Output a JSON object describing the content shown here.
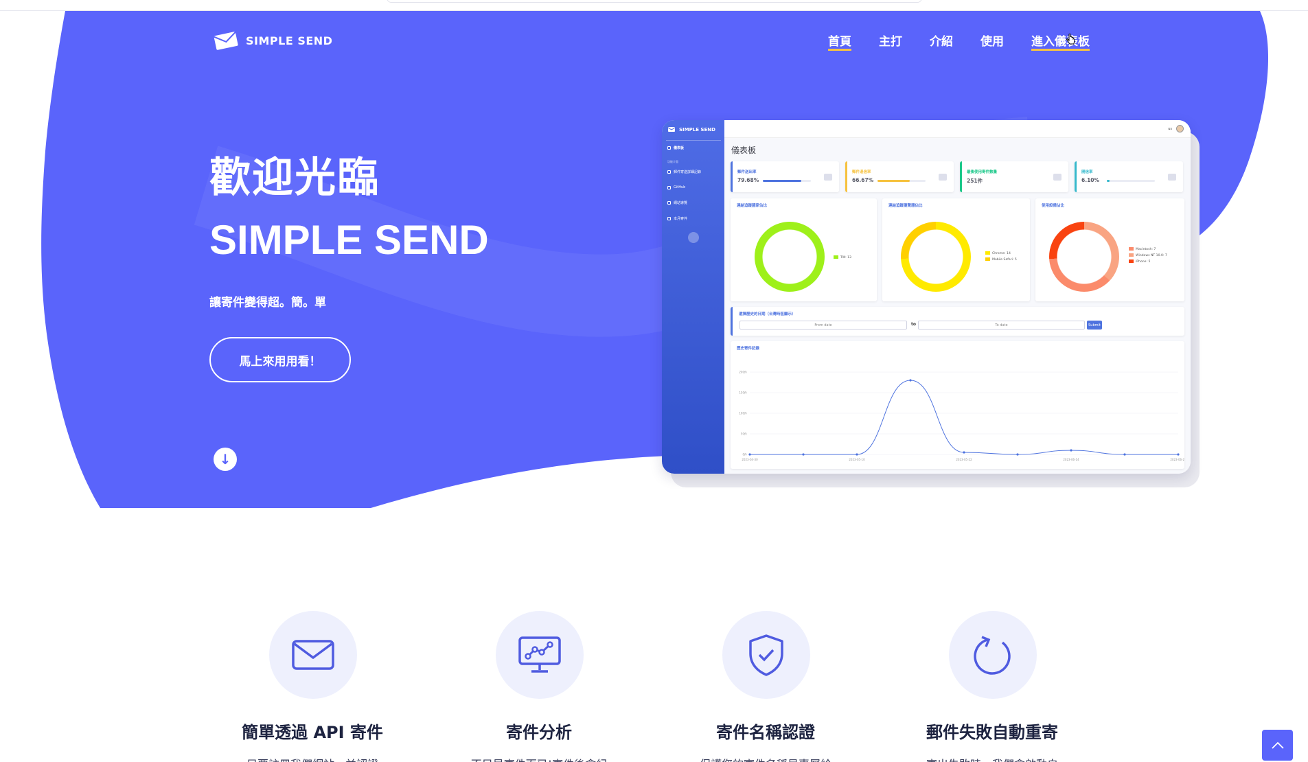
{
  "brand": {
    "name": "SIMPLE SEND"
  },
  "nav": {
    "items": [
      {
        "label": "首頁"
      },
      {
        "label": "主打"
      },
      {
        "label": "介紹"
      },
      {
        "label": "使用"
      },
      {
        "label": "進入儀表板"
      }
    ]
  },
  "hero": {
    "title": "歡迎光臨",
    "subtitle": "SIMPLE SEND",
    "tagline": "讓寄件變得超。簡。單",
    "cta": "馬上來用用看！",
    "scroll_icon": "↓"
  },
  "dashboard": {
    "brand": "SIMPLE SEND",
    "title": "儀表板",
    "flag": "us",
    "sidebar": {
      "home": "儀表板",
      "section": "功能介面",
      "items": [
        "郵件寄送詳細記錄",
        "GitHub",
        "網站導覽",
        "本月寄件"
      ]
    },
    "kpis": [
      {
        "label": "郵件送出率",
        "value": "79.68%",
        "progress": 0.8,
        "color": "#4e73df"
      },
      {
        "label": "郵件退信率",
        "value": "66.67%",
        "progress": 0.67,
        "color": "#f6c23e"
      },
      {
        "label": "最後使用寄件數量",
        "value": "251件",
        "progress": null,
        "color": "#1cc88a"
      },
      {
        "label": "開信率",
        "value": "6.10%",
        "progress": 0.06,
        "color": "#36b9cc"
      }
    ],
    "donuts": [
      {
        "title": "連結追蹤國家佔比",
        "legend": [
          {
            "label": "TW: 13",
            "color": "#9ef01a"
          }
        ],
        "segments": [
          {
            "color": "#9ef01a",
            "share": 1
          }
        ]
      },
      {
        "title": "連結追蹤瀏覽器佔比",
        "legend": [
          {
            "label": "Chrome: 14",
            "color": "#ffea00"
          },
          {
            "label": "Mobile Safari: 5",
            "color": "#ffd000"
          }
        ],
        "segments": [
          {
            "color": "#ffea00",
            "share": 0.74
          },
          {
            "color": "#ffd000",
            "share": 0.26
          }
        ]
      },
      {
        "title": "使用設備佔比",
        "legend": [
          {
            "label": "Macintosh: 7",
            "color": "#fb8b6b"
          },
          {
            "label": "Windows NT 10.0: 7",
            "color": "#f9a482"
          },
          {
            "label": "iPhone: 5",
            "color": "#f94310"
          }
        ],
        "segments": [
          {
            "color": "#f9a482",
            "share": 0.37
          },
          {
            "color": "#fb8b6b",
            "share": 0.37
          },
          {
            "color": "#f94310",
            "share": 0.26
          }
        ]
      }
    ],
    "date_filter": {
      "title": "選擇歷史的日期（台灣時區顯示）",
      "from_placeholder": "From date",
      "to_label": "to",
      "to_placeholder": "To date",
      "submit": "Submit"
    },
    "history": {
      "title": "歷史寄件記錄"
    }
  },
  "chart_data": {
    "type": "line",
    "title": "歷史寄件記錄",
    "x": [
      "2023-04-30",
      "",
      "2023-05-10",
      "",
      "2023-05-22",
      "",
      "2023-06-14",
      "",
      "2023-06-28"
    ],
    "y_ticks": [
      "0件",
      "50件",
      "100件",
      "150件",
      "200件"
    ],
    "ylim": [
      0,
      200
    ],
    "series": [
      {
        "values": [
          0,
          0,
          0,
          180,
          5,
          0,
          10,
          0,
          0
        ],
        "color": "#4e73df"
      }
    ]
  },
  "features": [
    {
      "icon": "mail-icon",
      "title": "簡單透過 API 寄件",
      "desc": "只要註冊我們網站，並認證"
    },
    {
      "icon": "analytics-monitor-icon",
      "title": "寄件分析",
      "desc": "不只是寄件而已!寄件後會紀"
    },
    {
      "icon": "shield-check-icon",
      "title": "寄件名稱認證",
      "desc": "保護您的寄件名稱是專屬給"
    },
    {
      "icon": "refresh-icon",
      "title": "郵件失敗自動重寄",
      "desc": "寄出失敗時，我們會啟動自"
    }
  ],
  "colors": {
    "hero": "#5a64fb",
    "accent": "#f6c244"
  }
}
